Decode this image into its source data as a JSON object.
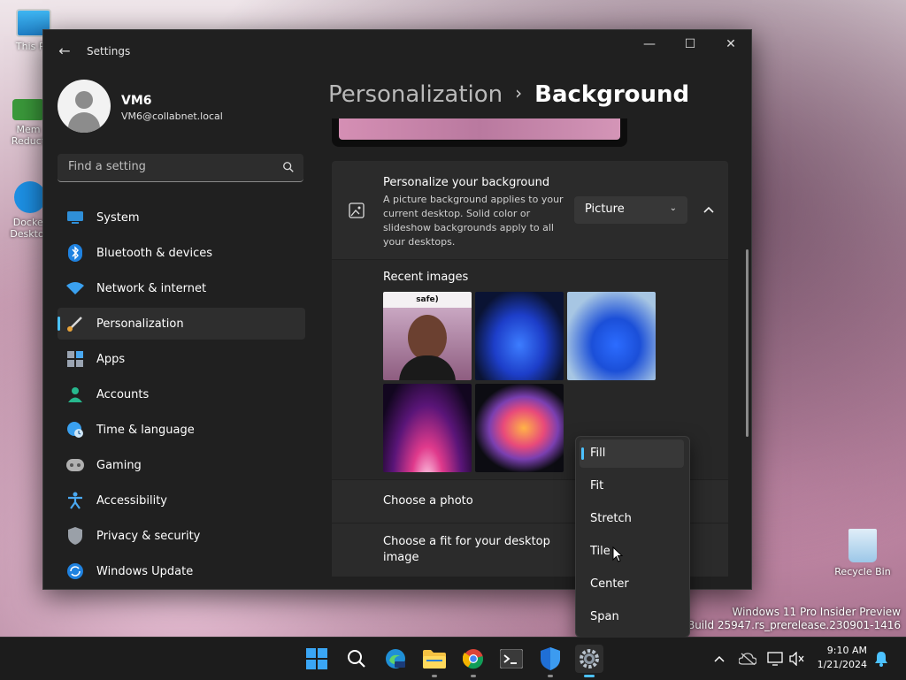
{
  "desktop": {
    "icons": [
      "This PC",
      "Mem Reduct",
      "Docker Desktop",
      "Recycle Bin"
    ],
    "watermark_line1": "Windows 11 Pro Insider Preview",
    "watermark_line2": "Evaluation copy. Build 25947.rs_prerelease.230901-1416"
  },
  "window": {
    "title": "Settings",
    "controls": {
      "minimize": "—",
      "maximize": "☐",
      "close": "✕"
    }
  },
  "profile": {
    "name": "VM6",
    "email": "VM6@collabnet.local"
  },
  "search": {
    "placeholder": "Find a setting"
  },
  "nav": {
    "items": [
      {
        "label": "System",
        "icon": "system-icon",
        "color": "#2f8fd8"
      },
      {
        "label": "Bluetooth & devices",
        "icon": "bluetooth-icon",
        "color": "#1f82e0"
      },
      {
        "label": "Network & internet",
        "icon": "wifi-icon",
        "color": "#3aa0ef"
      },
      {
        "label": "Personalization",
        "icon": "brush-icon",
        "color": "#e8a33a",
        "active": true
      },
      {
        "label": "Apps",
        "icon": "apps-icon",
        "color": "#9aa4b2"
      },
      {
        "label": "Accounts",
        "icon": "accounts-icon",
        "color": "#27b88e"
      },
      {
        "label": "Time & language",
        "icon": "globe-clock-icon",
        "color": "#3aa0ef"
      },
      {
        "label": "Gaming",
        "icon": "controller-icon",
        "color": "#b0b0b0"
      },
      {
        "label": "Accessibility",
        "icon": "accessibility-icon",
        "color": "#4aa8f0"
      },
      {
        "label": "Privacy & security",
        "icon": "shield-icon",
        "color": "#9aa0a8"
      },
      {
        "label": "Windows Update",
        "icon": "update-icon",
        "color": "#1f82e0"
      }
    ]
  },
  "breadcrumb": {
    "parent": "Personalization",
    "separator": "›",
    "current": "Background"
  },
  "background": {
    "title": "Personalize your background",
    "description": "A picture background applies to your current desktop. Solid color or slideshow backgrounds apply to all your desktops.",
    "type_value": "Picture",
    "recent_images_label": "Recent images",
    "thumb_caption": "safe)",
    "choose_photo_label": "Choose a photo",
    "choose_fit_label": "Choose a fit for your desktop image"
  },
  "fit_menu": {
    "options": [
      "Fill",
      "Fit",
      "Stretch",
      "Tile",
      "Center",
      "Span"
    ],
    "selected": "Fill"
  },
  "taskbar": {
    "apps": [
      "start-icon",
      "search-icon",
      "edge-beta-icon",
      "file-explorer-icon",
      "chrome-icon",
      "terminal-icon",
      "defender-icon",
      "settings-icon"
    ],
    "active_app": "settings-icon",
    "time": "9:10 AM",
    "date": "1/21/2024"
  },
  "colors": {
    "accent": "#4cc2ff",
    "window_bg": "#202020",
    "card_bg": "#2b2b2b"
  }
}
